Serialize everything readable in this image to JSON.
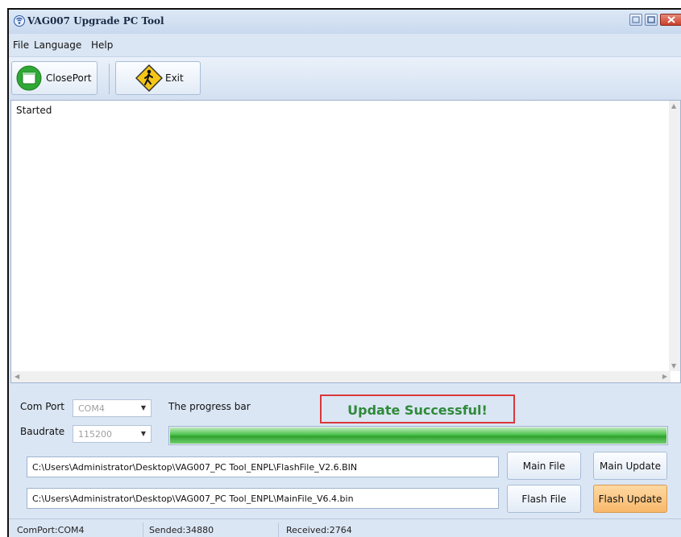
{
  "window": {
    "title": "VAG007 Upgrade PC Tool"
  },
  "menu": [
    "File",
    "Language",
    "Help"
  ],
  "toolbar": {
    "close_port_label": "ClosePort",
    "exit_label": "Exit"
  },
  "log": {
    "text": "Started"
  },
  "settings": {
    "com_port_label": "Com Port",
    "com_port_value": "COM4",
    "baudrate_label": "Baudrate",
    "baudrate_value": "115200"
  },
  "progress": {
    "label": "The progress bar",
    "value": 1.0,
    "message": "Update Successful!"
  },
  "files": {
    "flash_path": "C:\\Users\\Administrator\\Desktop\\VAG007_PC Tool_ENPL\\FlashFile_V2.6.BIN",
    "main_path": "C:\\Users\\Administrator\\Desktop\\VAG007_PC Tool_ENPL\\MainFile_V6.4.bin"
  },
  "buttons": {
    "main_file": "Main File",
    "main_update": "Main Update",
    "flash_file": "Flash File",
    "flash_update": "Flash Update"
  },
  "status": {
    "comport": "ComPort:COM4",
    "sended": "Sended:34880",
    "received": "Received:2764"
  },
  "colors": {
    "success_text": "#2f8a3a",
    "success_border": "#d9383a",
    "progress_fill": "#3fb53f",
    "flash_update_bg": "#f7b86a"
  },
  "icons": {
    "app": "signal-icon",
    "close_port": "window-icon",
    "exit": "pedestrian-warning-icon"
  }
}
